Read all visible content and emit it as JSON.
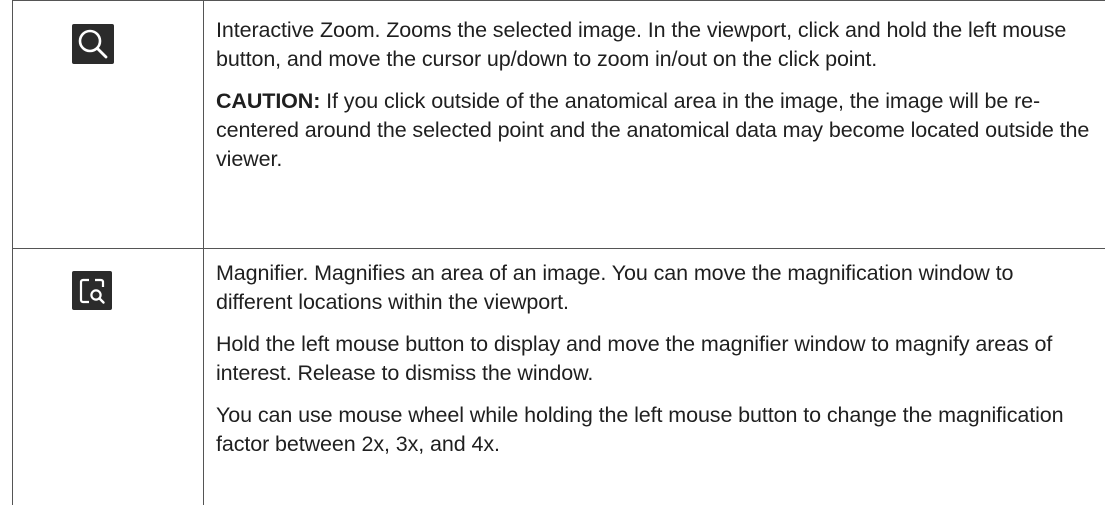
{
  "rows": [
    {
      "icon": "zoom-magnifying-glass-icon",
      "paragraphs": [
        "Interactive Zoom. Zooms the selected image. In the viewport, click and hold the left mouse button, and move the cursor up/down to zoom in/out on the click point."
      ],
      "caution": {
        "label": "CAUTION:",
        "text": " If you click outside of the anatomical area in the image, the image will be re-centered around the selected point and the anatomical data may become located outside the viewer."
      }
    },
    {
      "icon": "magnifier-window-icon",
      "paragraphs": [
        "Magnifier. Magnifies an area of an image. You can move the magnification window to different locations within the viewport.",
        "Hold the left mouse button to display and move the magnifier window to magnify areas of interest. Release to dismiss the window.",
        "You can use mouse wheel while holding the left mouse button to change the magnification factor between 2x, 3x, and 4x."
      ]
    }
  ],
  "colors": {
    "icon_background": "#2b2b2b",
    "icon_foreground": "#ffffff",
    "border": "#555555",
    "text": "#1f1f1f"
  }
}
